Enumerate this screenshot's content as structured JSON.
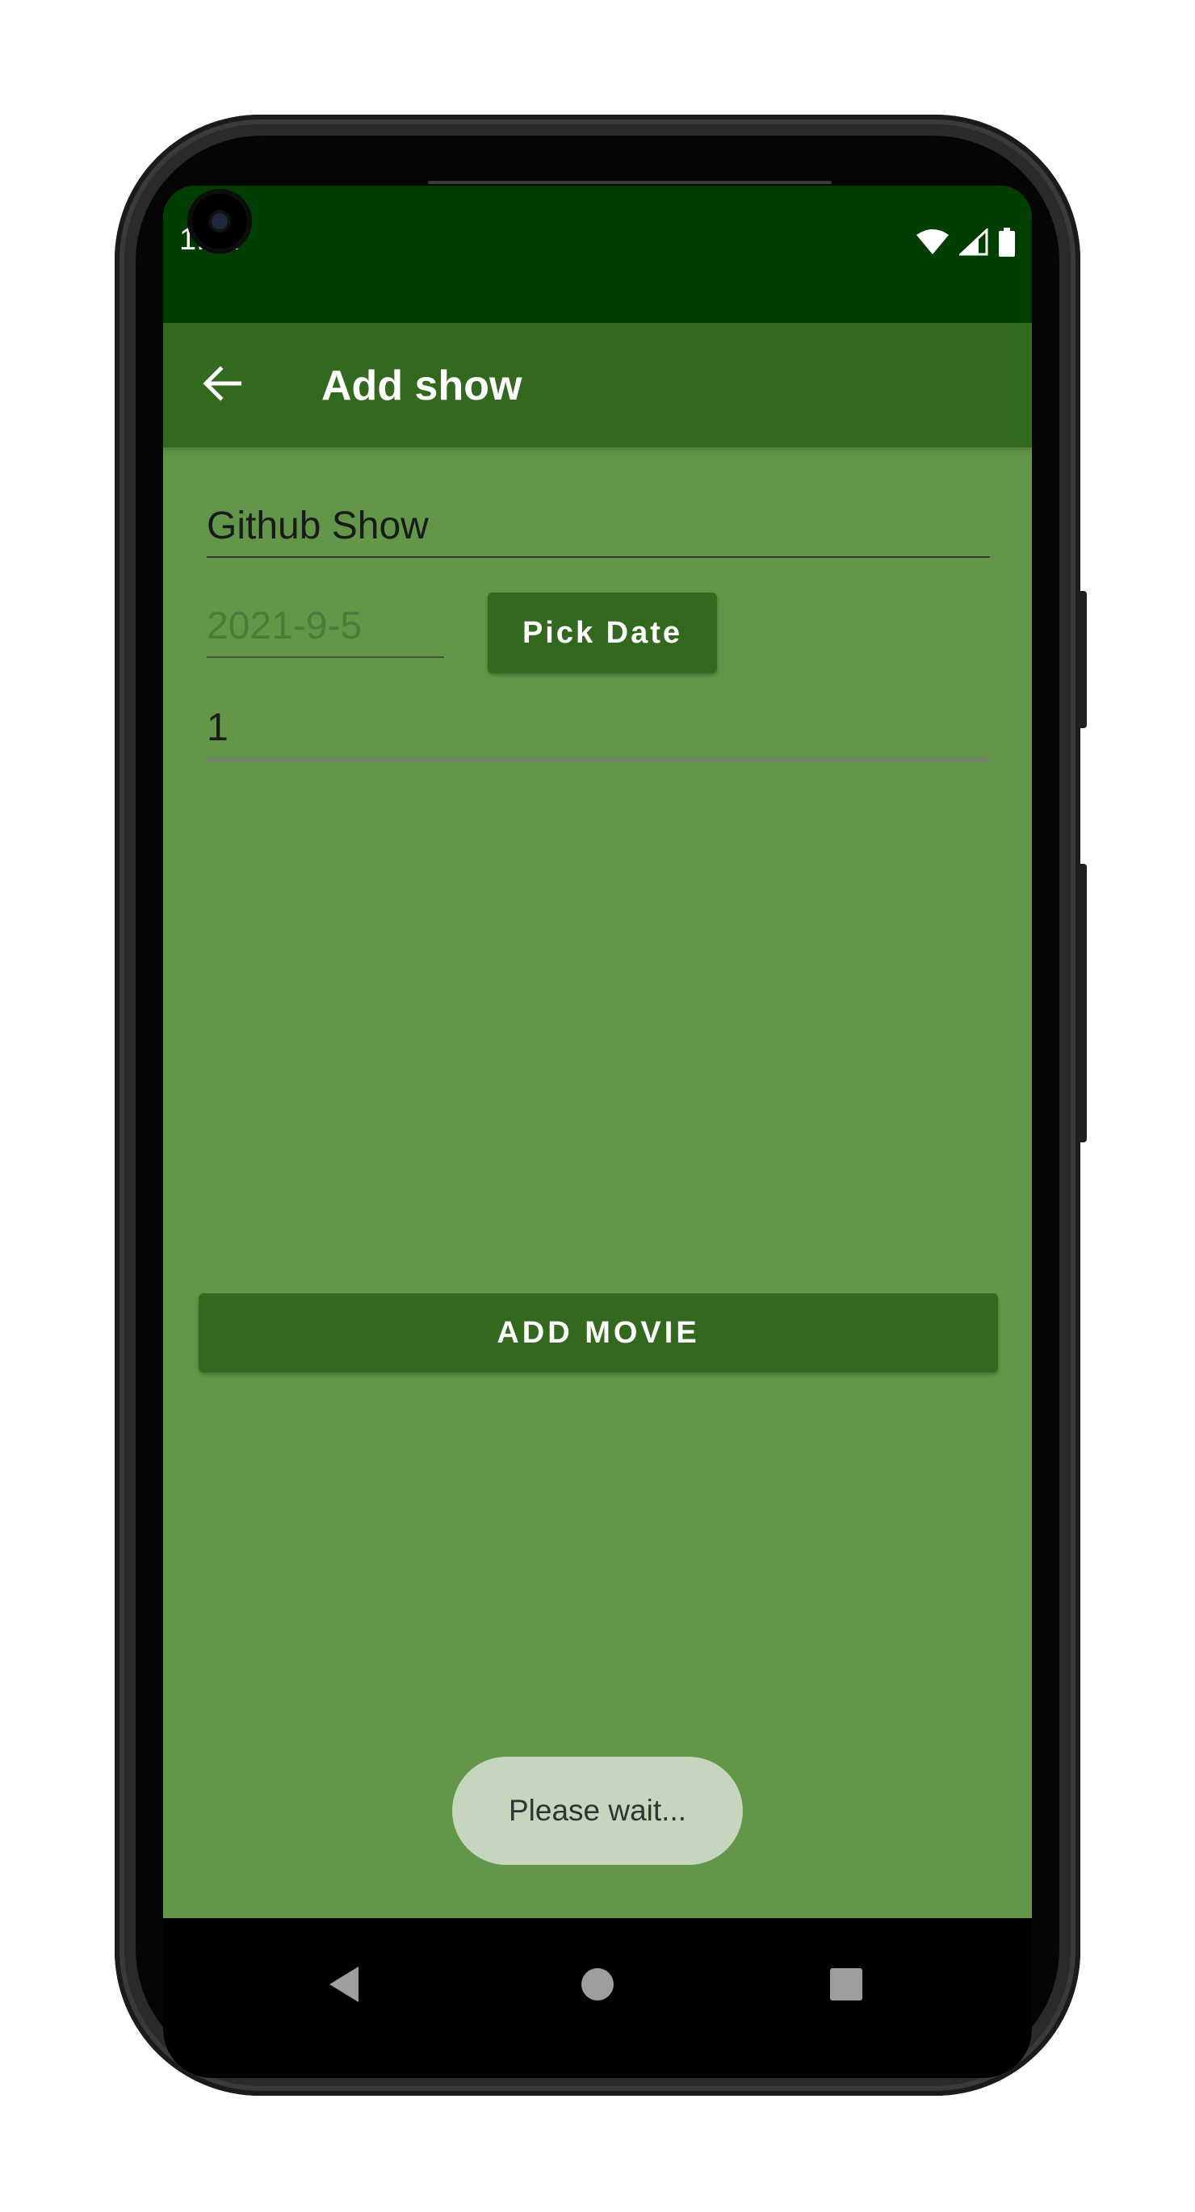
{
  "status_bar": {
    "time": "1:22",
    "icons": [
      "wifi-icon",
      "cell-signal-icon",
      "battery-icon"
    ]
  },
  "app_bar": {
    "back_icon": "arrow-back-icon",
    "title": "Add show"
  },
  "form": {
    "title_value": "Github Show",
    "date_value": "2021-9-5",
    "pick_date_label": "Pick Date",
    "episodes_value": "1",
    "add_movie_label": "ADD MOVIE"
  },
  "toast": {
    "message": "Please wait..."
  },
  "nav_bar": {
    "icons": [
      "nav-back-icon",
      "nav-home-icon",
      "nav-recents-icon"
    ]
  },
  "colors": {
    "status_bar": "#003d00",
    "app_bar": "#33691e",
    "background": "#629749",
    "button": "#33691e",
    "toast": "#c6d6be"
  }
}
